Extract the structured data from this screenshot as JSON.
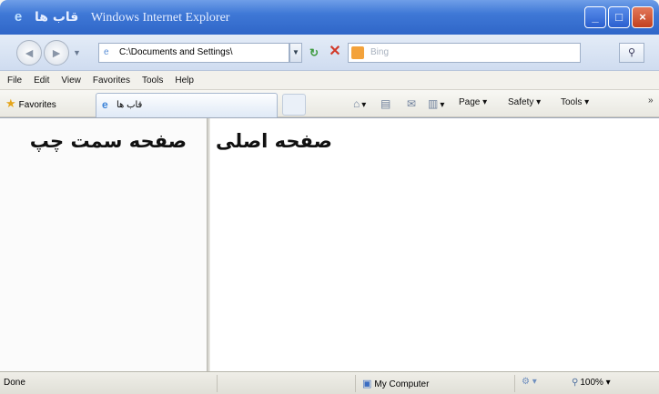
{
  "window": {
    "title_tab": "قاب ها",
    "title_app": "Windows Internet Explorer",
    "buttons": {
      "minimize": "_",
      "maximize": "□",
      "close": "×"
    }
  },
  "address_bar": {
    "back": "◄",
    "forward": "►",
    "url": "C:\\Documents and Settings\\",
    "search_placeholder": "Bing"
  },
  "menu": [
    "File",
    "Edit",
    "View",
    "Favorites",
    "Tools",
    "Help"
  ],
  "favorites_bar": {
    "favorites_label": "Favorites",
    "tab_label": "قاب ها",
    "commands": {
      "page": "Page ▾",
      "safety": "Safety ▾",
      "tools": "Tools ▾"
    }
  },
  "content": {
    "left_frame_text": "صفحه سمت چپ",
    "right_frame_text": "صفحه اصلی"
  },
  "status_bar": {
    "text": "Done",
    "zone": "My Computer",
    "zoom": "100%"
  }
}
